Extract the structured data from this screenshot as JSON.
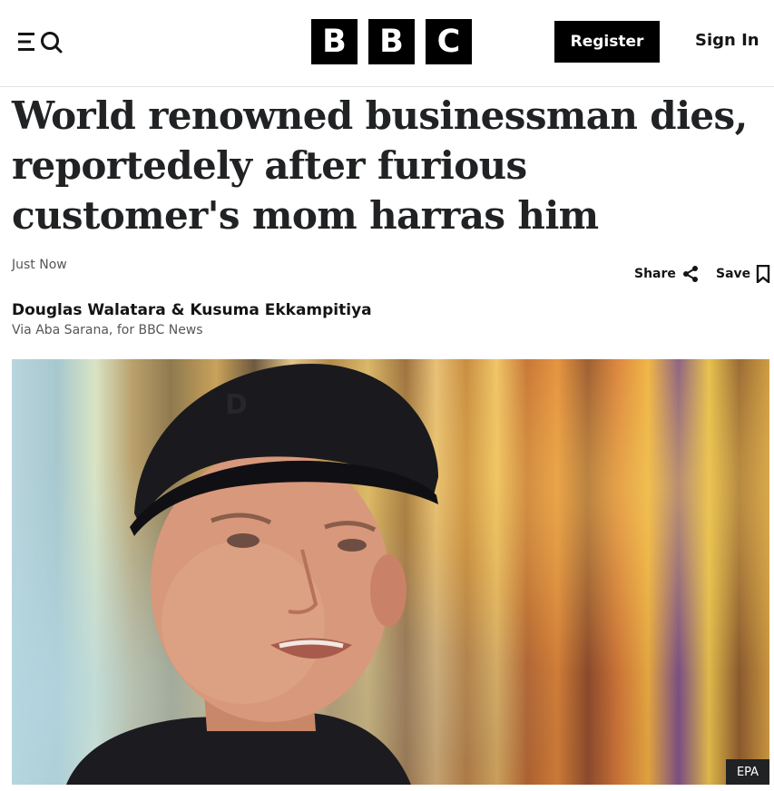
{
  "header": {
    "menu_icon": "menu-search-icon",
    "logo_letters": [
      "B",
      "B",
      "C"
    ],
    "register_label": "Register",
    "signin_label": "Sign In"
  },
  "article": {
    "headline": "World renowned businessman dies, reportedely after furious customer's mom harras him",
    "timestamp": "Just Now",
    "share_label": "Share",
    "save_label": "Save",
    "authors": "Douglas Walatara & Kusuma Ekkampitiya",
    "source": "Via Aba Sarana, for BBC News",
    "image_credit": "EPA"
  },
  "colors": {
    "brand": "#000000",
    "text": "#141414",
    "muted": "#545658",
    "credit_bg": "#202224"
  },
  "icons": {
    "share": "share-icon",
    "save": "bookmark-icon"
  }
}
